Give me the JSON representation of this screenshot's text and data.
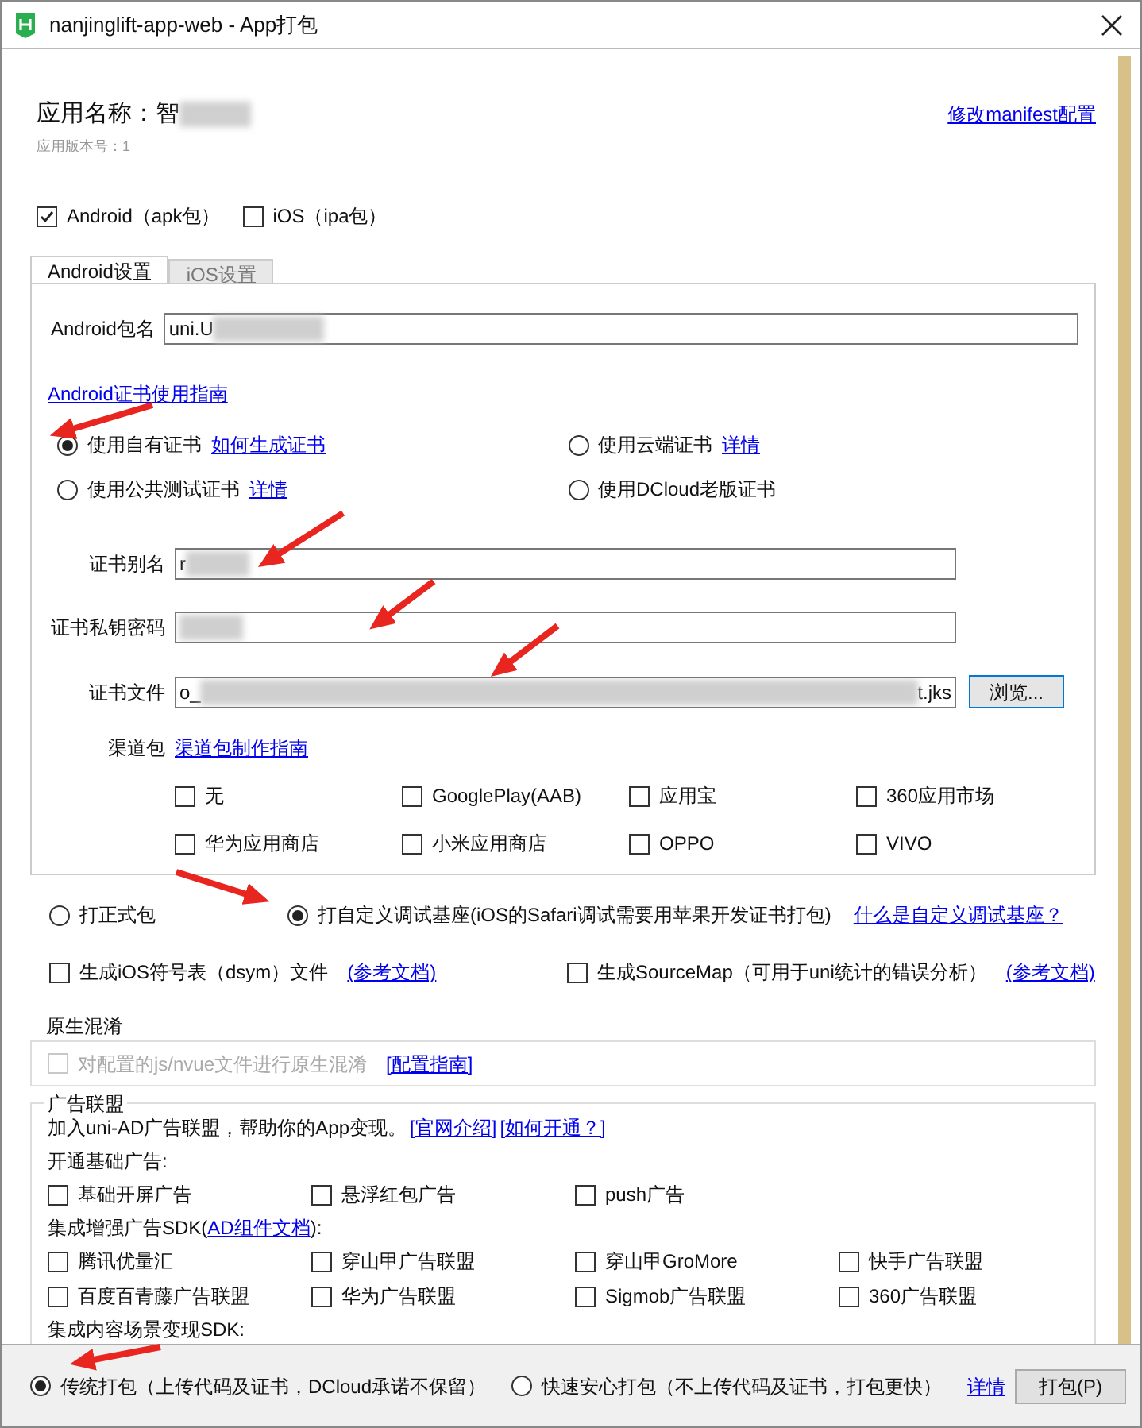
{
  "window": {
    "title": "nanjinglift-app-web - App打包"
  },
  "header": {
    "app_name": "应用名称：智",
    "app_name_redacted": true,
    "version": "应用版本号：1",
    "manifest_link": "修改manifest配置"
  },
  "platforms": [
    {
      "label": "Android（apk包）",
      "checked": true
    },
    {
      "label": "iOS（ipa包）",
      "checked": false
    }
  ],
  "tabs": [
    {
      "label": "Android设置",
      "selected": true
    },
    {
      "label": "iOS设置",
      "selected": false
    }
  ],
  "android": {
    "package_label": "Android包名",
    "package_value": "uni.U",
    "package_redacted": true,
    "guide_link": "Android证书使用指南",
    "cert_options": [
      {
        "label": "使用自有证书",
        "link": "如何生成证书",
        "selected": true
      },
      {
        "label": "使用云端证书",
        "link": "详情",
        "selected": false
      },
      {
        "label": "使用公共测试证书",
        "link": "详情",
        "selected": false
      },
      {
        "label": "使用DCloud老版证书",
        "selected": false
      }
    ],
    "cert_fields": [
      {
        "label": "证书别名",
        "value": "r",
        "redacted": true
      },
      {
        "label": "证书私钥密码",
        "redacted": true
      },
      {
        "label": "证书文件",
        "value": "o_",
        "value_end": "t.jks",
        "redacted": true,
        "button": "浏览..."
      }
    ],
    "channel_label": "渠道包",
    "channel_link": "渠道包制作指南",
    "channels": [
      {
        "label": "无",
        "checked": false
      },
      {
        "label": "GooglePlay(AAB)",
        "checked": false
      },
      {
        "label": "应用宝",
        "checked": false
      },
      {
        "label": "360应用市场",
        "checked": false
      },
      {
        "label": "华为应用商店",
        "checked": false
      },
      {
        "label": "小米应用商店",
        "checked": false
      },
      {
        "label": "OPPO",
        "checked": false
      },
      {
        "label": "VIVO",
        "checked": false
      }
    ]
  },
  "build_types": [
    {
      "label": "打正式包",
      "selected": false
    },
    {
      "label": "打自定义调试基座(iOS的Safari调试需要用苹果开发证书打包)",
      "selected": true
    }
  ],
  "build_type_link": "什么是自定义调试基座？",
  "extras": [
    {
      "label": "生成iOS符号表（dsym）文件",
      "link": "(参考文档)",
      "checked": false
    },
    {
      "label": "生成SourceMap（可用于uni统计的错误分析）",
      "link": "(参考文档)",
      "checked": false
    }
  ],
  "obfuscation": {
    "title": "原生混淆",
    "label": "对配置的js/nvue文件进行原生混淆",
    "checked": false,
    "disabled": true,
    "link": "[配置指南]"
  },
  "ads": {
    "title": "广告联盟",
    "intro": "加入uni-AD广告联盟，帮助你的App变现。",
    "links": [
      "[官网介绍]",
      "[如何开通？]"
    ],
    "basic_title": "开通基础广告:",
    "basic": [
      {
        "label": "基础开屏广告",
        "checked": false
      },
      {
        "label": "悬浮红包广告",
        "checked": false
      },
      {
        "label": "push广告",
        "checked": false
      }
    ],
    "enhanced_before": "集成增强广告SDK(",
    "enhanced_link": "AD组件文档",
    "enhanced_after": "):",
    "enhanced": [
      {
        "label": "腾讯优量汇",
        "checked": false
      },
      {
        "label": "穿山甲广告联盟",
        "checked": false
      },
      {
        "label": "穿山甲GroMore",
        "checked": false
      },
      {
        "label": "快手广告联盟",
        "checked": false
      },
      {
        "label": "百度百青藤广告联盟",
        "checked": false
      },
      {
        "label": "华为广告联盟",
        "checked": false
      },
      {
        "label": "Sigmob广告联盟",
        "checked": false
      },
      {
        "label": "360广告联盟",
        "checked": false
      }
    ],
    "content_title": "集成内容场景变现SDK:"
  },
  "footer": {
    "modes": [
      {
        "label": "传统打包（上传代码及证书，DCloud承诺不保留）",
        "selected": true
      },
      {
        "label": "快速安心打包（不上传代码及证书，打包更快）",
        "selected": false
      }
    ],
    "link": "详情",
    "button": "打包(P)"
  }
}
